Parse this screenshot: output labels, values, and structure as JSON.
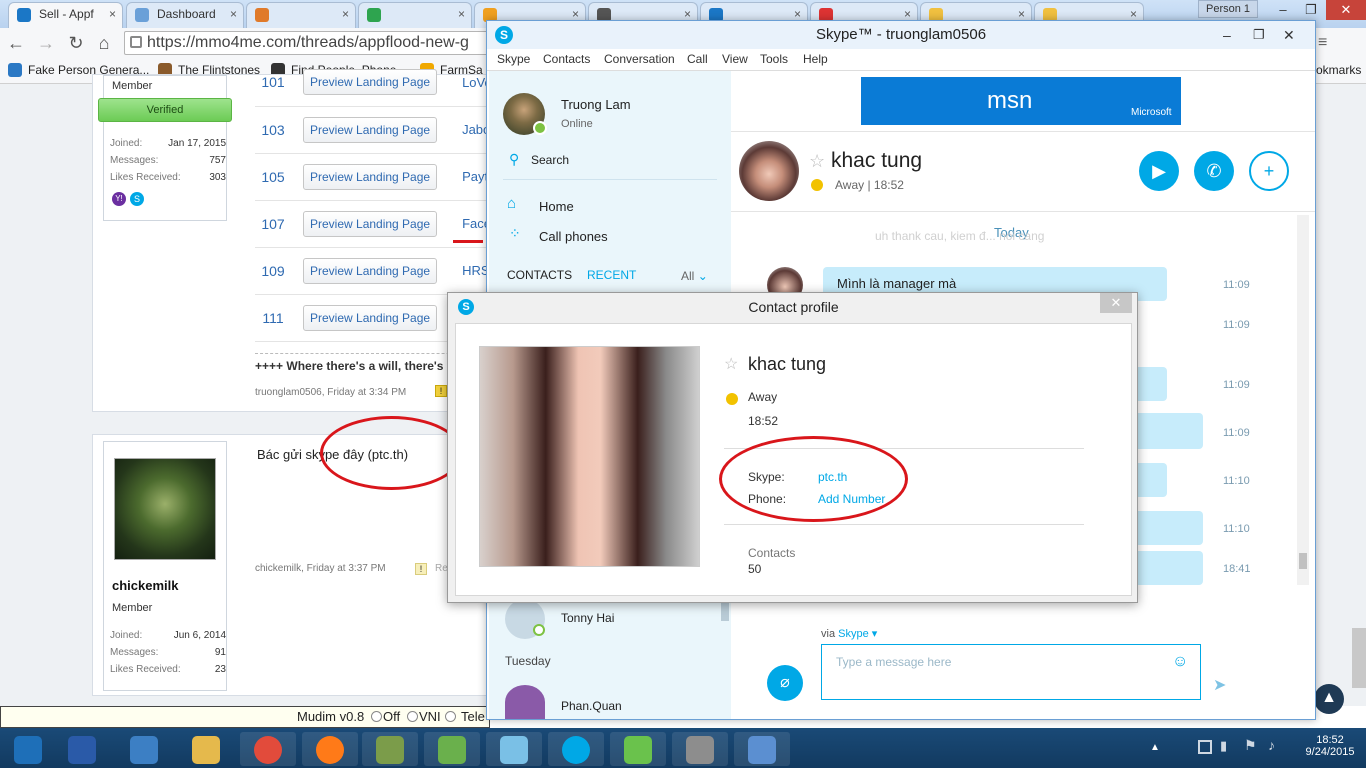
{
  "browser": {
    "tabs": [
      {
        "label": "Sell - Appf",
        "active": true,
        "color": "#1b77c6"
      },
      {
        "label": "Dashboard",
        "active": false,
        "color": "#6aa0d8"
      },
      {
        "label": "",
        "active": false,
        "color": "#e07a2a"
      },
      {
        "label": "",
        "active": false,
        "color": "#2ea44f"
      },
      {
        "label": "",
        "active": false,
        "color": "#f0a020"
      },
      {
        "label": "",
        "active": false,
        "color": "#555555"
      },
      {
        "label": "",
        "active": false,
        "color": "#1b77c6"
      },
      {
        "label": "",
        "active": false,
        "color": "#d33"
      },
      {
        "label": "",
        "active": false,
        "color": "#f0c040"
      },
      {
        "label": "",
        "active": false,
        "color": "#f0c040"
      }
    ],
    "profile_label": "Person 1",
    "url": "https://mmo4me.com/threads/appflood-new-g",
    "bookmarks": [
      "Fake Person Genera...",
      "The Flintstones",
      "Find People, Phone ...",
      "FarmSa"
    ],
    "bookmarks_right": "okmarks"
  },
  "forum": {
    "post1": {
      "role": "Member",
      "badge": "Verified",
      "stats": [
        {
          "label": "Joined:",
          "value": "Jan 17, 2015"
        },
        {
          "label": "Messages:",
          "value": "757"
        },
        {
          "label": "Likes Received:",
          "value": "303"
        }
      ],
      "rows": [
        {
          "num": "101",
          "button": "Preview Landing Page",
          "name": "LoVo"
        },
        {
          "num": "103",
          "button": "Preview Landing Page",
          "name": "Jabo"
        },
        {
          "num": "105",
          "button": "Preview Landing Page",
          "name": "Payt"
        },
        {
          "num": "107",
          "button": "Preview Landing Page",
          "name": "Face"
        },
        {
          "num": "109",
          "button": "Preview Landing Page",
          "name": "HRS"
        },
        {
          "num": "111",
          "button": "Preview Landing Page",
          "name": ""
        }
      ],
      "signature": "++++ Where there's a will, there's a",
      "meta": "truonglam0506, Friday at 3:34 PM"
    },
    "post2": {
      "username": "chickemilk",
      "role": "Member",
      "stats": [
        {
          "label": "Joined:",
          "value": "Jun 6, 2014"
        },
        {
          "label": "Messages:",
          "value": "91"
        },
        {
          "label": "Likes Received:",
          "value": "23"
        }
      ],
      "message": "Bác gửi skype đây (ptc.th)",
      "meta": "chickemilk, Friday at 3:37 PM",
      "reply": "Re"
    }
  },
  "mudim": {
    "label": "Mudim v0.8",
    "opt1": "Off",
    "opt2": "VNI",
    "opt3": "Tele"
  },
  "skype": {
    "title": "Skype™ - truonglam0506",
    "menu": [
      "Skype",
      "Contacts",
      "Conversation",
      "Call",
      "View",
      "Tools",
      "Help"
    ],
    "me": {
      "name": "Truong Lam",
      "status": "Online"
    },
    "search": "Search",
    "home": "Home",
    "call_phones": "Call phones",
    "contacts_tab": "CONTACTS",
    "recent_tab": "RECENT",
    "filter": "All",
    "contacts_list": [
      {
        "name": "Tonny Hai"
      },
      {
        "name": "Phan.Quan"
      }
    ],
    "day_label": "Tuesday",
    "ad_text": "msn",
    "ad_brand": "Microsoft",
    "chat": {
      "name": "khac tung",
      "status": "Away | 18:52",
      "today": "Today",
      "faded": "uh thank cau, kiem đ... noi cang",
      "messages": [
        {
          "text": "Mình là manager mà",
          "time": "11:09"
        },
        {
          "text": "",
          "time": "11:09"
        },
        {
          "text": "",
          "time": "11:09"
        },
        {
          "text": "",
          "time": "11:09"
        },
        {
          "text": "",
          "time": "11:10"
        },
        {
          "text": "",
          "time": "11:10"
        },
        {
          "text": "",
          "time": "18:41"
        }
      ],
      "via": "via",
      "via_link": "Skype",
      "input_placeholder": "Type a message here"
    },
    "accent": "#00a8e6"
  },
  "profile_dialog": {
    "title": "Contact profile",
    "name": "khac tung",
    "status": "Away",
    "time": "18:52",
    "skype_label": "Skype:",
    "skype_value": "ptc.th",
    "phone_label": "Phone:",
    "phone_value": "Add Number",
    "contacts_label": "Contacts",
    "contacts_value": "50"
  },
  "taskbar": {
    "icons": [
      "start-icon",
      "powershell-icon",
      "remote-desktop-icon",
      "file-explorer-icon",
      "chrome-icon",
      "firefox-icon",
      "money-app-icon",
      "chat-app-icon",
      "notepad-icon",
      "skype-icon",
      "bluestacks-icon",
      "network-app-icon",
      "paint-icon"
    ],
    "time": "18:52",
    "date": "9/24/2015"
  }
}
